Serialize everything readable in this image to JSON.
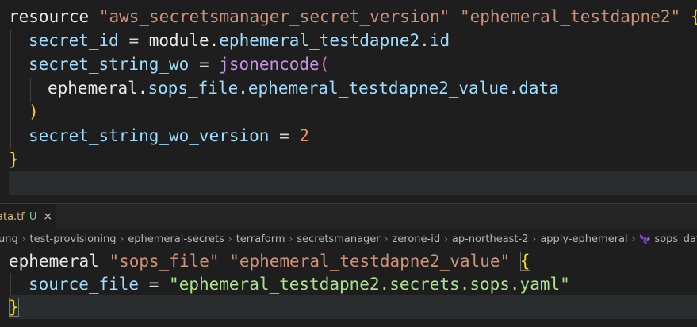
{
  "editor_top": {
    "lines": [
      {
        "t1": "resource",
        "t2": "\"aws_secretsmanager_secret_version\"",
        "t3": "\"ephemeral_testdapne2\"",
        "t4": "{"
      },
      {
        "t1": "secret_id",
        "t2": "=",
        "t3": "module.",
        "t4": "ephemeral_testdapne2",
        "t5": ".id"
      },
      {
        "t1": "secret_string_wo",
        "t2": "=",
        "t3": "jsonencode",
        "t4": "("
      },
      {
        "t1": "ephemeral.",
        "t2": "sops_file",
        "t3": ".",
        "t4": "ephemeral_testdapne2_value",
        "t5": ".data"
      },
      {
        "t1": ")"
      },
      {
        "t1": "secret_string_wo_version",
        "t2": "=",
        "t3": "2"
      },
      {
        "t1": "}"
      }
    ]
  },
  "tab": {
    "name": "ata.tf",
    "status": "U",
    "close": "×"
  },
  "breadcrumb": {
    "items": [
      "ung",
      "test-provisioning",
      "ephemeral-secrets",
      "terraform",
      "secretsmanager",
      "zerone-id",
      "ap-northeast-2",
      "apply-ephemeral",
      "sops_data.tf"
    ],
    "separator": "›"
  },
  "editor_bottom": {
    "lines": [
      {
        "t1": "ephemeral",
        "t2": "\"sops_file\"",
        "t3": "\"ephemeral_testdapne2_value\"",
        "t4": "{"
      },
      {
        "t1": "source_file",
        "t2": "=",
        "t3": "\"ephemeral_testdapne2.secrets.sops.yaml\""
      },
      {
        "t1": "}"
      }
    ]
  }
}
